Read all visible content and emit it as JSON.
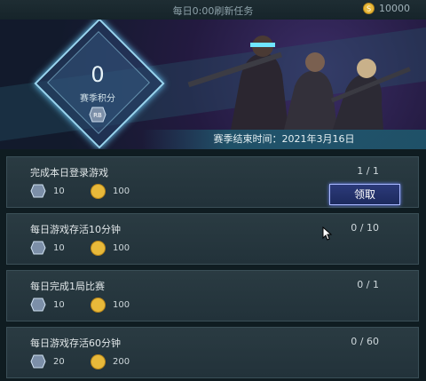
{
  "header": {
    "refresh_text": "每日0:00刷新任务",
    "coin_balance": "10000"
  },
  "banner": {
    "score": "0",
    "score_label": "赛季积分",
    "end_time_text": "赛季结束时间：2021年3月16日"
  },
  "tasks": [
    {
      "title": "完成本日登录游戏",
      "progress": "1 / 1",
      "badge_reward": "10",
      "coin_reward": "100",
      "claim_label": "领取"
    },
    {
      "title": "每日游戏存活10分钟",
      "progress": "0 / 10",
      "badge_reward": "10",
      "coin_reward": "100"
    },
    {
      "title": "每日完成1局比赛",
      "progress": "0 / 1",
      "badge_reward": "10",
      "coin_reward": "100"
    },
    {
      "title": "每日游戏存活60分钟",
      "progress": "0 / 60",
      "badge_reward": "20",
      "coin_reward": "200"
    }
  ],
  "colors": {
    "accent": "#9ad6f0",
    "claim_border": "#a9b8ff",
    "coin": "#e8b93a"
  }
}
